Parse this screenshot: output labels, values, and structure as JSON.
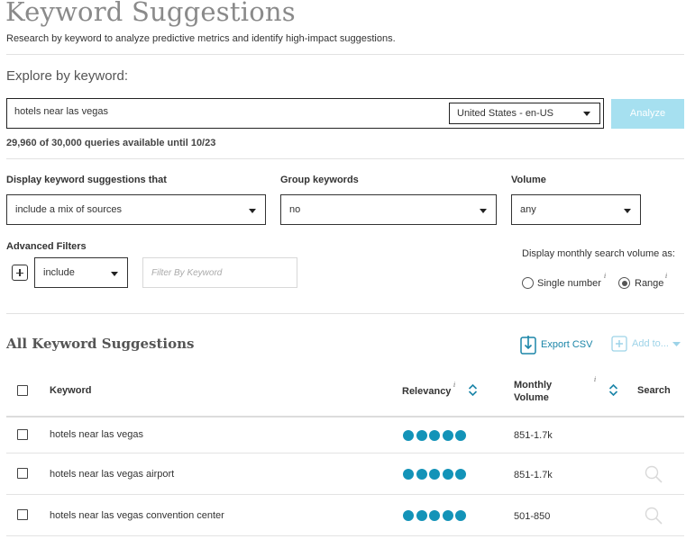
{
  "header": {
    "title": "Keyword Suggestions",
    "subtitle": "Research by keyword to analyze predictive metrics and identify high-impact suggestions."
  },
  "explore": {
    "label": "Explore by keyword:",
    "keyword_value": "hotels near las vegas",
    "locale": "United States - en-US",
    "analyze_label": "Analyze",
    "quota": "29,960 of 30,000 queries available until 10/23"
  },
  "filters": {
    "display_label": "Display keyword suggestions that",
    "display_value": "include a mix of sources",
    "group_label": "Group keywords",
    "group_value": "no",
    "volume_label": "Volume",
    "volume_value": "any",
    "advanced_label": "Advanced Filters",
    "include_value": "include",
    "filter_placeholder": "Filter By Keyword",
    "monthly_label": "Display monthly search volume as:",
    "single_number": "Single number",
    "range": "Range",
    "selected_mode": "range"
  },
  "results": {
    "title": "All Keyword Suggestions",
    "export_label": "Export CSV",
    "add_to_label": "Add to...",
    "columns": {
      "keyword": "Keyword",
      "relevancy": "Relevancy",
      "monthly": "Monthly",
      "volume": "Volume",
      "search": "Search"
    },
    "rows": [
      {
        "keyword": "hotels near las vegas",
        "relevancy": 5,
        "volume": "851-1.7k"
      },
      {
        "keyword": "hotels near las vegas airport",
        "relevancy": 5,
        "volume": "851-1.7k"
      },
      {
        "keyword": "hotels near las vegas convention center",
        "relevancy": 5,
        "volume": "501-850"
      }
    ]
  },
  "colors": {
    "accent": "#1393b8",
    "analyze_button": "#a6e0f0",
    "link": "#1b85a8"
  },
  "icons": [
    "plus-icon",
    "caret-down-icon",
    "info-icon",
    "sort-icon",
    "export-icon",
    "add-icon",
    "search-icon"
  ]
}
